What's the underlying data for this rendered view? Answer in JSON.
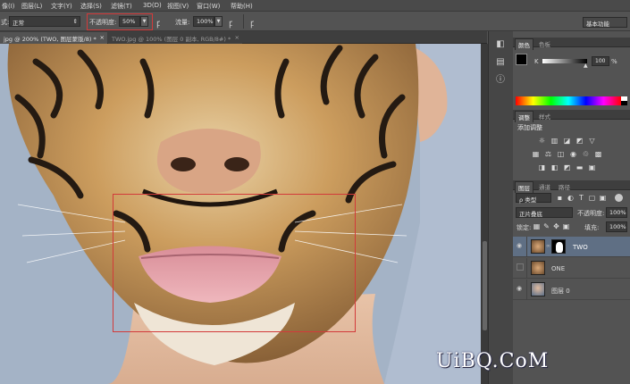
{
  "menubar": {
    "items": [
      "像(I)",
      "图层(L)",
      "文字(Y)",
      "选择(S)",
      "滤镜(T)",
      "3D(D)",
      "视图(V)",
      "窗口(W)",
      "帮助(H)"
    ]
  },
  "options": {
    "mode_label": "式:",
    "mode_value": "正常",
    "opacity_label": "不透明度:",
    "opacity_value": "50%",
    "flow_label": "流量:",
    "flow_value": "100%",
    "workspace": "基本功能"
  },
  "doc_tabs": [
    {
      "label": "jpg @ 200% (TWO, 图层蒙版/8) *",
      "active": true,
      "close": "×"
    },
    {
      "label": "TWO.jpg @ 100% (图层 0 副本, RGB/8#) *",
      "active": false,
      "close": "×"
    }
  ],
  "color_panel": {
    "tabs": [
      "颜色",
      "色板"
    ],
    "channel_label": "K",
    "channel_value": "100",
    "percent": "%"
  },
  "adjust_panel": {
    "tabs": [
      "调整",
      "样式"
    ],
    "title": "添加调整"
  },
  "layers_panel": {
    "tabs": [
      "图层",
      "通道",
      "路径"
    ],
    "filter_label": "ρ 类型",
    "blend_mode": "正片叠底",
    "opacity_label": "不透明度:",
    "opacity_value": "100%",
    "lock_label": "锁定:",
    "fill_label": "填充:",
    "fill_value": "100%",
    "layers": [
      {
        "name": "TWO",
        "visible": true,
        "selected": true,
        "has_mask": true
      },
      {
        "name": "ONE",
        "visible": false,
        "selected": false,
        "has_mask": false
      },
      {
        "name": "图层 0",
        "visible": true,
        "selected": false,
        "has_mask": false
      }
    ]
  },
  "watermark": "UiBQ.CoM",
  "colors": {
    "accent_red": "#d23a3a",
    "panel_bg": "#535353",
    "selected_layer": "#5f6f84"
  }
}
